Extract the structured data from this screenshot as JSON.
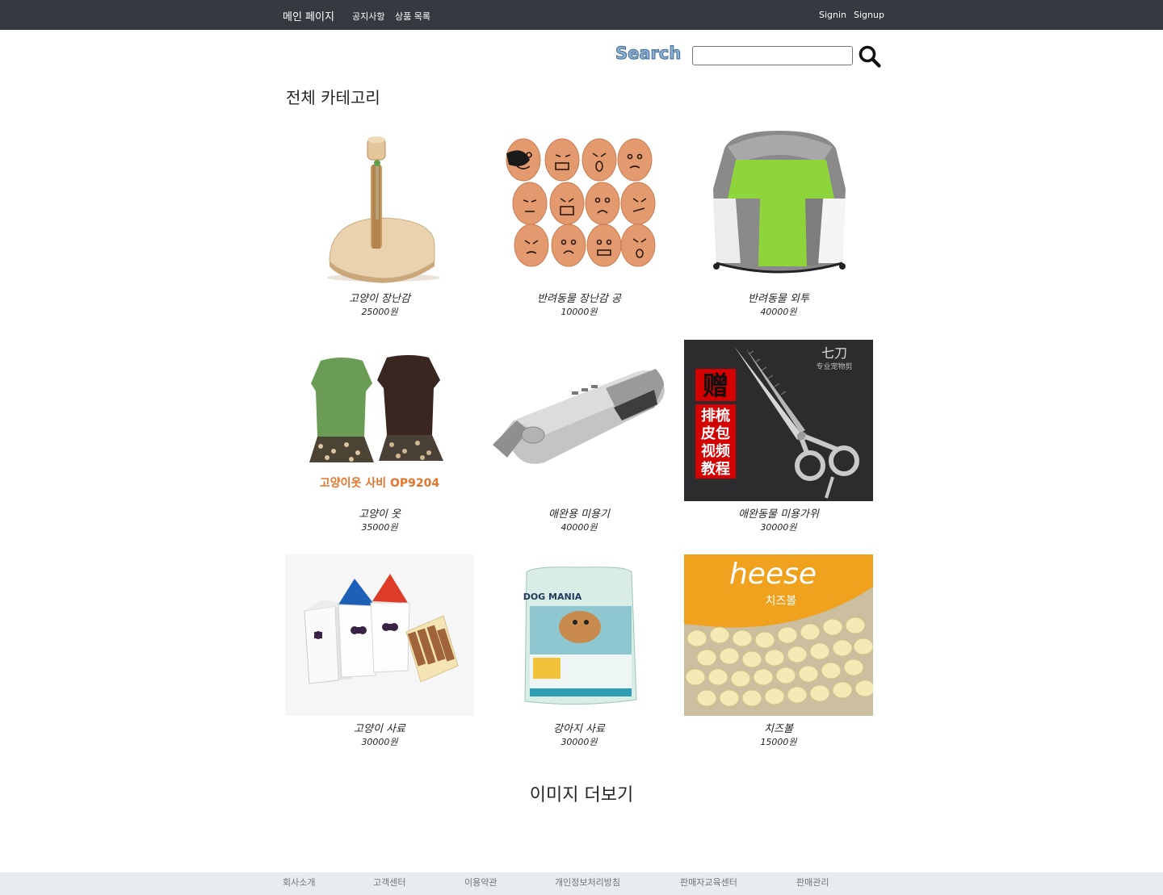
{
  "nav": {
    "brand": "메인 페이지",
    "links": [
      "공지사항",
      "상품 목록"
    ],
    "auth": [
      "Signin",
      "Signup"
    ]
  },
  "search": {
    "label": "Search",
    "value": "",
    "icon": "search-icon"
  },
  "category_title": "전체 카테고리",
  "products": [
    {
      "name": "고양이 장난감",
      "price": "25000원"
    },
    {
      "name": "반려동물 장난감 공",
      "price": "10000원"
    },
    {
      "name": "반려동물 외투",
      "price": "40000원"
    },
    {
      "name": "고양이 옷",
      "price": "35000원"
    },
    {
      "name": "애완용 미용기",
      "price": "40000원"
    },
    {
      "name": "애완동물 미용가위",
      "price": "30000원"
    },
    {
      "name": "고양이 사료",
      "price": "30000원"
    },
    {
      "name": "강아지 사료",
      "price": "30000원"
    },
    {
      "name": "치즈볼",
      "price": "15000원"
    }
  ],
  "image_text": {
    "cat_clothes_caption": "고양이옷 사비 OP9204",
    "scissors_brand": "七刀",
    "scissors_sub": "专业宠物剪",
    "scissors_gift": "赠",
    "scissors_items": [
      "排梳",
      "皮包",
      "视频",
      "教程"
    ],
    "dogfood_brand": "DOG MANIA",
    "cheese_word": "heese",
    "cheese_kor": "치즈볼"
  },
  "more_images": "이미지 더보기",
  "footer": {
    "links": [
      "회사소개",
      "고객센터",
      "이용약관",
      "개인정보처리방침",
      "판매자교육센터",
      "판매관리"
    ]
  }
}
